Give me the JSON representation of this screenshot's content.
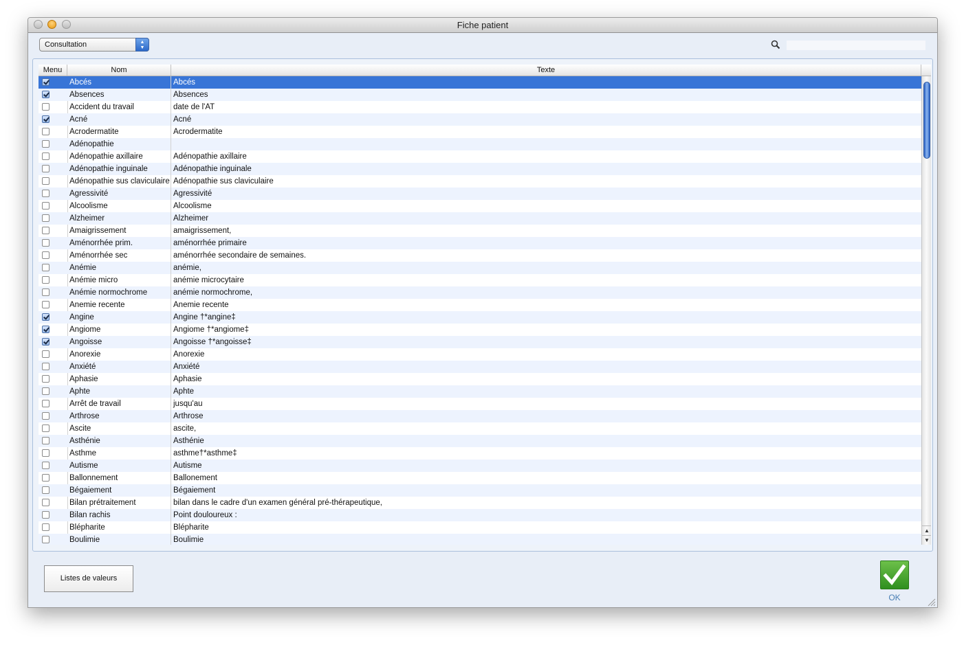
{
  "window": {
    "title": "Fiche patient"
  },
  "toolbar": {
    "select_value": "Consultation",
    "search_placeholder": ""
  },
  "table": {
    "columns": [
      "Menu",
      "Nom",
      "Texte"
    ],
    "rows": [
      {
        "checked": true,
        "nom": "Abcés",
        "texte": "Abcés",
        "selected": true
      },
      {
        "checked": true,
        "nom": "Absences",
        "texte": "Absences"
      },
      {
        "checked": false,
        "nom": "Accident du travail",
        "texte": "date de l'AT"
      },
      {
        "checked": true,
        "nom": "Acné",
        "texte": "Acné"
      },
      {
        "checked": false,
        "nom": "Acrodermatite",
        "texte": "Acrodermatite"
      },
      {
        "checked": false,
        "nom": "Adénopathie",
        "texte": ""
      },
      {
        "checked": false,
        "nom": "Adénopathie axillaire",
        "texte": "Adénopathie axillaire"
      },
      {
        "checked": false,
        "nom": "Adénopathie inguinale",
        "texte": "Adénopathie inguinale"
      },
      {
        "checked": false,
        "nom": "Adénopathie sus claviculaire",
        "texte": "Adénopathie sus claviculaire"
      },
      {
        "checked": false,
        "nom": "Agressivité",
        "texte": "Agressivité"
      },
      {
        "checked": false,
        "nom": "Alcoolisme",
        "texte": "Alcoolisme"
      },
      {
        "checked": false,
        "nom": "Alzheimer",
        "texte": "Alzheimer"
      },
      {
        "checked": false,
        "nom": "Amaigrissement",
        "texte": "amaigrissement,"
      },
      {
        "checked": false,
        "nom": "Aménorrhée prim.",
        "texte": "aménorrhée primaire"
      },
      {
        "checked": false,
        "nom": "Aménorrhée sec",
        "texte": "aménorrhée secondaire de      semaines."
      },
      {
        "checked": false,
        "nom": "Anémie",
        "texte": "anémie,"
      },
      {
        "checked": false,
        "nom": "Anémie micro",
        "texte": "anémie microcytaire"
      },
      {
        "checked": false,
        "nom": "Anémie normochrome",
        "texte": "anémie normochrome,"
      },
      {
        "checked": false,
        "nom": "Anemie recente",
        "texte": "Anemie recente"
      },
      {
        "checked": true,
        "nom": "Angine",
        "texte": "Angine †*angine‡"
      },
      {
        "checked": true,
        "nom": "Angiome",
        "texte": "Angiome †*angiome‡"
      },
      {
        "checked": true,
        "nom": "Angoisse",
        "texte": "Angoisse †*angoisse‡"
      },
      {
        "checked": false,
        "nom": "Anorexie",
        "texte": "Anorexie"
      },
      {
        "checked": false,
        "nom": "Anxiété",
        "texte": "Anxiété"
      },
      {
        "checked": false,
        "nom": "Aphasie",
        "texte": "Aphasie"
      },
      {
        "checked": false,
        "nom": "Aphte",
        "texte": "Aphte"
      },
      {
        "checked": false,
        "nom": "Arrêt de travail",
        "texte": "jusqu'au"
      },
      {
        "checked": false,
        "nom": "Arthrose",
        "texte": "Arthrose"
      },
      {
        "checked": false,
        "nom": "Ascite",
        "texte": "ascite,"
      },
      {
        "checked": false,
        "nom": "Asthénie",
        "texte": "Asthénie"
      },
      {
        "checked": false,
        "nom": "Asthme",
        "texte": "asthme†*asthme‡"
      },
      {
        "checked": false,
        "nom": "Autisme",
        "texte": "Autisme"
      },
      {
        "checked": false,
        "nom": "Ballonnement",
        "texte": "Ballonement"
      },
      {
        "checked": false,
        "nom": "Bégaiement",
        "texte": "Bégaiement"
      },
      {
        "checked": false,
        "nom": "Bilan prétraitement",
        "texte": "bilan dans le cadre d'un examen général pré-thérapeutique,"
      },
      {
        "checked": false,
        "nom": "Bilan rachis",
        "texte": "Point douloureux :"
      },
      {
        "checked": false,
        "nom": "Blépharite",
        "texte": " Blépharite"
      },
      {
        "checked": false,
        "nom": "Boulimie",
        "texte": "Boulimie"
      }
    ]
  },
  "footer": {
    "listes_label": "Listes de valeurs",
    "ok_label": "OK"
  },
  "colors": {
    "selection": "#3875d7",
    "ok_green": "#3f9f2a",
    "window_bg": "#e8eef7"
  },
  "icons": {
    "search": "magnifier-icon",
    "ok": "checkmark-icon"
  }
}
